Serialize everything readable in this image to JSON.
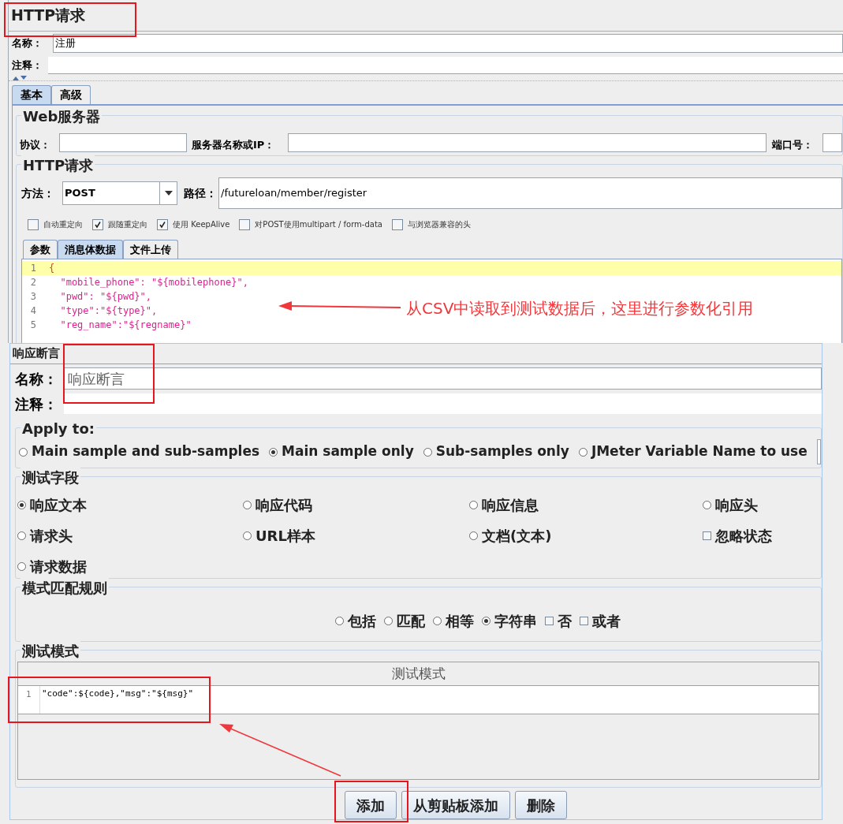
{
  "http_request": {
    "title": "HTTP请求",
    "name_label": "名称：",
    "name_value": "注册",
    "comment_label": "注释：",
    "tabs": [
      {
        "label": "基本",
        "selected": true
      },
      {
        "label": "高级",
        "selected": false
      }
    ],
    "web_server": {
      "title": "Web服务器",
      "protocol_label": "协议：",
      "server_label": "服务器名称或IP：",
      "port_label": "端口号："
    },
    "request": {
      "title": "HTTP请求",
      "method_label": "方法：",
      "method_value": "POST",
      "path_label": "路径：",
      "path_value": "/futureloan/member/register",
      "options": [
        {
          "label": "自动重定向",
          "checked": false
        },
        {
          "label": "跟随重定向",
          "checked": true
        },
        {
          "label": "使用 KeepAlive",
          "checked": true
        },
        {
          "label": "对POST使用multipart / form-data",
          "checked": false
        },
        {
          "label": "与浏览器兼容的头",
          "checked": false
        }
      ],
      "body_tabs": [
        {
          "label": "参数",
          "selected": false
        },
        {
          "label": "消息体数据",
          "selected": true
        },
        {
          "label": "文件上传",
          "selected": false
        }
      ],
      "body_lines": [
        {
          "number": "1",
          "text": "{",
          "current": true
        },
        {
          "number": "2",
          "text": "  \"mobile_phone\": \"${mobilephone}\",",
          "current": false
        },
        {
          "number": "3",
          "text": "  \"pwd\": \"${pwd}\",",
          "current": false
        },
        {
          "number": "4",
          "text": "  \"type\":\"${type}\",",
          "current": false
        },
        {
          "number": "5",
          "text": "  \"reg_name\":\"${regname}\"",
          "current": false
        }
      ]
    }
  },
  "annotation": "从CSV中读取到测试数据后，这里进行参数化引用",
  "response_assertion": {
    "title": "响应断言",
    "name_label": "名称：",
    "name_value": "响应断言",
    "comment_label": "注释：",
    "apply_to": {
      "title": "Apply to:",
      "options": [
        {
          "label": "Main sample and sub-samples",
          "selected": false
        },
        {
          "label": "Main sample only",
          "selected": true
        },
        {
          "label": "Sub-samples only",
          "selected": false
        },
        {
          "label": "JMeter Variable Name to use",
          "selected": false
        }
      ]
    },
    "test_field": {
      "title": "测试字段",
      "options": [
        {
          "label": "响应文本",
          "kind": "radio",
          "selected": true
        },
        {
          "label": "响应代码",
          "kind": "radio",
          "selected": false
        },
        {
          "label": "响应信息",
          "kind": "radio",
          "selected": false
        },
        {
          "label": "响应头",
          "kind": "radio",
          "selected": false
        },
        {
          "label": "请求头",
          "kind": "radio",
          "selected": false
        },
        {
          "label": "URL样本",
          "kind": "radio",
          "selected": false
        },
        {
          "label": "文档(文本)",
          "kind": "radio",
          "selected": false
        },
        {
          "label": "忽略状态",
          "kind": "checkbox",
          "selected": false
        },
        {
          "label": "请求数据",
          "kind": "radio",
          "selected": false
        }
      ]
    },
    "matching_rules": {
      "title": "模式匹配规则",
      "options": [
        {
          "label": "包括",
          "kind": "radio",
          "selected": false
        },
        {
          "label": "匹配",
          "kind": "radio",
          "selected": false
        },
        {
          "label": "相等",
          "kind": "radio",
          "selected": false
        },
        {
          "label": "字符串",
          "kind": "radio",
          "selected": true
        },
        {
          "label": "否",
          "kind": "checkbox",
          "selected": false
        },
        {
          "label": "或者",
          "kind": "checkbox",
          "selected": false
        }
      ]
    },
    "patterns": {
      "title": "测试模式",
      "column": "测试模式",
      "rows": [
        {
          "number": "1",
          "text": "\"code\":${code},\"msg\":\"${msg}\""
        }
      ]
    },
    "buttons": [
      "添加",
      "从剪贴板添加",
      "删除"
    ]
  }
}
